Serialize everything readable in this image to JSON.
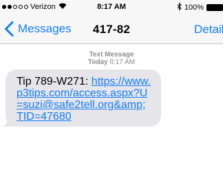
{
  "status_bar": {
    "signal_dots": [
      true,
      true,
      false,
      false,
      false
    ],
    "carrier": "Verizon",
    "wifi_icon": "wifi-icon",
    "time": "8:17 AM",
    "bluetooth_icon": "bluetooth-icon",
    "battery": "100%"
  },
  "nav": {
    "back_label": "Messages",
    "title": "417-82",
    "details_label": "Details"
  },
  "thread": {
    "message_kind": "Text Message",
    "date_day": "Today",
    "date_time": "8:17 AM",
    "message": {
      "prefix": "Tip 789-W271: ",
      "link": "https://www.p3tips.com/access.aspx?U=suzi@safe2tell.org&amp;TID=47680"
    }
  },
  "colors": {
    "accent": "#147efb",
    "bubble_gray": "#e5e5ea",
    "meta_gray": "#8e8e93"
  }
}
